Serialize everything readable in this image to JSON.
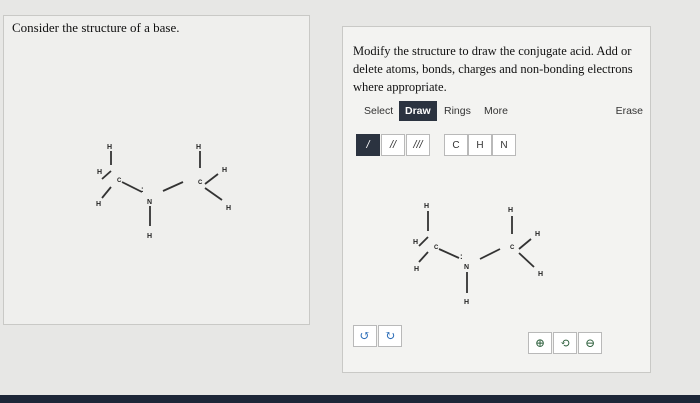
{
  "left_panel": {
    "prompt": "Consider the structure of a base."
  },
  "right_panel": {
    "instructions": "Modify the structure to draw the conjugate acid. Add or delete atoms, bonds, charges and non-bonding electrons where appropriate.",
    "toolbar": {
      "tabs": [
        "Select",
        "Draw",
        "Rings",
        "More"
      ],
      "active_tab": "Draw",
      "erase_label": "Erase"
    },
    "bond_tools": [
      "/",
      "//",
      "///"
    ],
    "atom_tools": [
      "C",
      "H",
      "N"
    ],
    "undo_icon": "undo-icon",
    "redo_icon": "redo-icon",
    "zoom_icons": [
      "zoom-in-icon",
      "reset-zoom-icon",
      "zoom-out-icon"
    ]
  },
  "molecule": {
    "atoms": {
      "h_labels": [
        "H",
        "H",
        "H",
        "H",
        "H",
        "H",
        "H"
      ],
      "c_labels": [
        "C",
        "C"
      ],
      "n_label": "N",
      "lone_pair": ":"
    }
  },
  "colors": {
    "accent_dark": "#2b3340",
    "icon_blue": "#2f6fb8",
    "zoom_green": "#2b5e3a"
  }
}
